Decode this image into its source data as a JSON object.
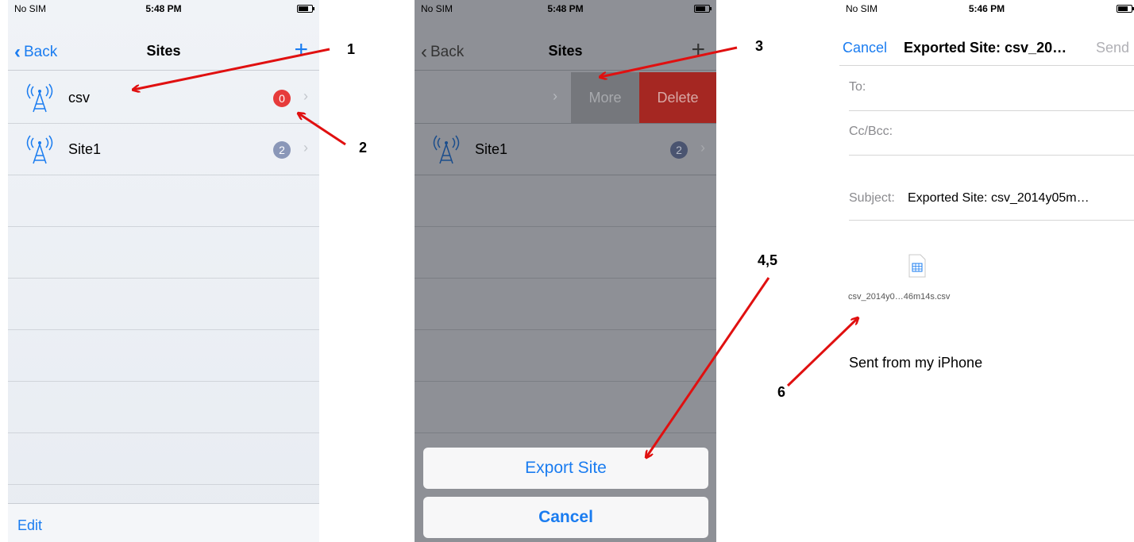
{
  "screen1": {
    "status": {
      "carrier": "No SIM",
      "time": "5:48 PM"
    },
    "nav": {
      "back": "Back",
      "title": "Sites",
      "add_icon": "plus-icon"
    },
    "rows": [
      {
        "label": "csv",
        "badge": "0",
        "badge_color": "#e63b3b"
      },
      {
        "label": "Site1",
        "badge": "2",
        "badge_color": "#8a97b8"
      }
    ],
    "toolbar": {
      "edit": "Edit"
    }
  },
  "screen2": {
    "status": {
      "carrier": "No SIM",
      "time": "5:48 PM"
    },
    "nav": {
      "back": "Back",
      "title": "Sites"
    },
    "swipe_actions": {
      "more": "More",
      "delete": "Delete"
    },
    "rows": [
      {
        "label": "Site1",
        "badge": "2"
      }
    ],
    "action_sheet": {
      "export": "Export Site",
      "cancel": "Cancel"
    }
  },
  "screen3": {
    "status": {
      "carrier": "No SIM",
      "time": "5:46 PM"
    },
    "nav": {
      "cancel": "Cancel",
      "title": "Exported Site: csv_20…",
      "send": "Send"
    },
    "fields": {
      "to_label": "To:",
      "cc_label": "Cc/Bcc:",
      "subject_label": "Subject:",
      "subject_value": "Exported Site: csv_2014y05m…"
    },
    "attachment": {
      "filename": "csv_2014y0…46m14s.csv"
    },
    "body": {
      "signature": "Sent from my iPhone"
    }
  },
  "annotations": {
    "n1": "1",
    "n2": "2",
    "n3": "3",
    "n45": "4,5",
    "n6": "6"
  },
  "colors": {
    "ios_blue": "#1a7cf0",
    "arrow_red": "#e01010",
    "delete_red": "#d93a35"
  }
}
